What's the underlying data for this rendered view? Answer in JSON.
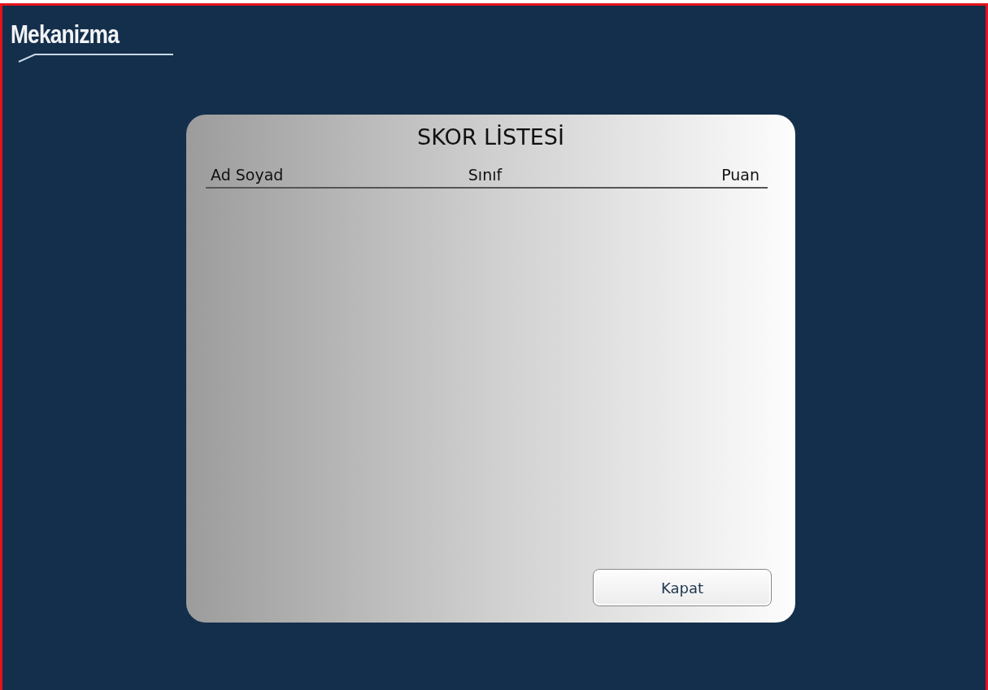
{
  "logo": {
    "text": "Mekanizma"
  },
  "dialog": {
    "title": "SKOR LİSTESİ",
    "columns": [
      "Ad Soyad",
      "Sınıf",
      "Puan"
    ],
    "buttons": [
      "Kapat"
    ]
  }
}
